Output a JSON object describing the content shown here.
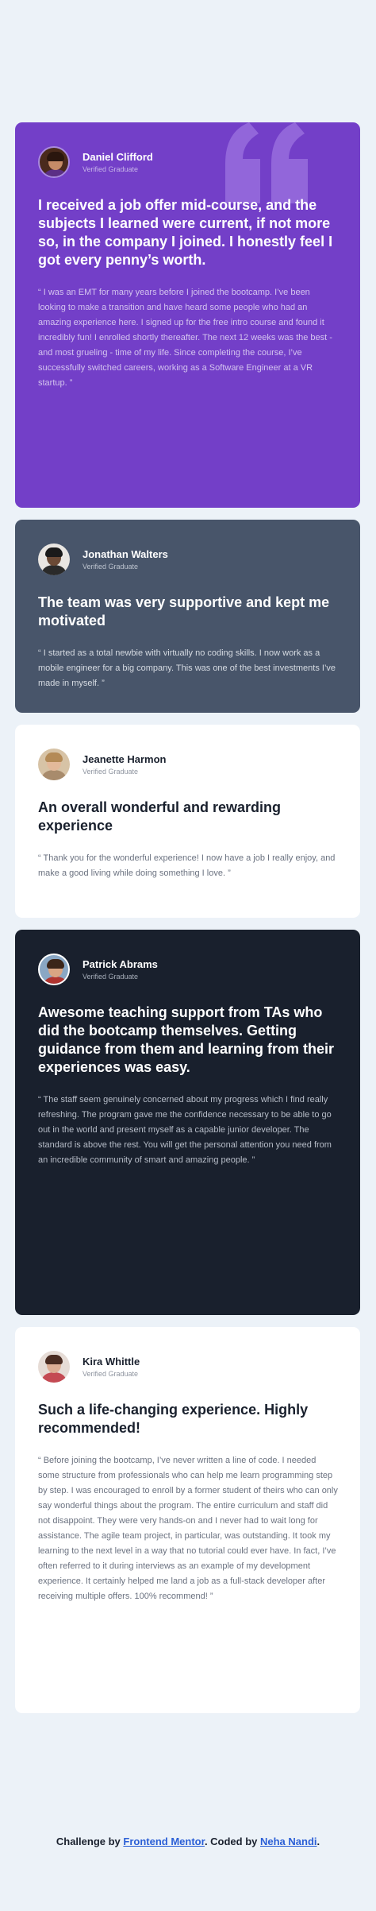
{
  "testimonials": [
    {
      "name": "Daniel Clifford",
      "status": "Verified Graduate",
      "headline": "I received a job offer mid-course, and the subjects I learned were current, if not more so, in the company I joined. I honestly feel I got every penny’s worth.",
      "quote": "“ I was an EMT for many years before I joined the bootcamp. I’ve been looking to make a transition and have heard some people who had an amazing experience here. I signed up for the free intro course and found it incredibly fun! I enrolled shortly thereafter. The next 12 weeks was the best - and most grueling - time of my life. Since completing the course, I’ve successfully switched careers, working as a Software Engineer at a VR startup. ”",
      "color": "#733fc8"
    },
    {
      "name": "Jonathan Walters",
      "status": "Verified Graduate",
      "headline": "The team was very supportive and kept me motivated",
      "quote": "“ I started as a total newbie with virtually no coding skills. I now work as a mobile engineer for a big company. This was one of the best investments I’ve made in myself. ”",
      "color": "#48556a"
    },
    {
      "name": "Jeanette Harmon",
      "status": "Verified Graduate",
      "headline": "An overall wonderful and rewarding experience",
      "quote": "“ Thank you for the wonderful experience! I now have a job I really enjoy, and make a good living while doing something I love. ”",
      "color": "#ffffff"
    },
    {
      "name": "Patrick Abrams",
      "status": "Verified Graduate",
      "headline": "Awesome teaching support from TAs who did the bootcamp themselves. Getting guidance from them and learning from their experiences was easy.",
      "quote": "“ The staff seem genuinely concerned about my progress which I find really refreshing. The program gave me the confidence necessary to be able to go out in the world and present myself as a capable junior developer. The standard is above the rest. You will get the personal attention you need from an incredible community of smart and amazing people. ”",
      "color": "#19202d"
    },
    {
      "name": "Kira Whittle",
      "status": "Verified Graduate",
      "headline": "Such a life-changing experience. Highly recommended!",
      "quote": "“ Before joining the bootcamp, I’ve never written a line of code. I needed some structure from professionals who can help me learn programming step by step. I was encouraged to enroll by a former student of theirs who can only say wonderful things about the program. The entire curriculum and staff did not disappoint. They were very hands-on and I never had to wait long for assistance. The agile team project, in particular, was outstanding. It took my learning to the next level in a way that no tutorial could ever have. In fact, I’ve often referred to it during interviews as an example of my development experience. It certainly helped me land a job as a full-stack developer after receiving multiple offers. 100% recommend! ”",
      "color": "#ffffff"
    }
  ],
  "footer": {
    "prefix": "Challenge by ",
    "link1": "Frontend Mentor",
    "middle": ". Coded by ",
    "link2": "Neha Nandi",
    "suffix": "."
  }
}
